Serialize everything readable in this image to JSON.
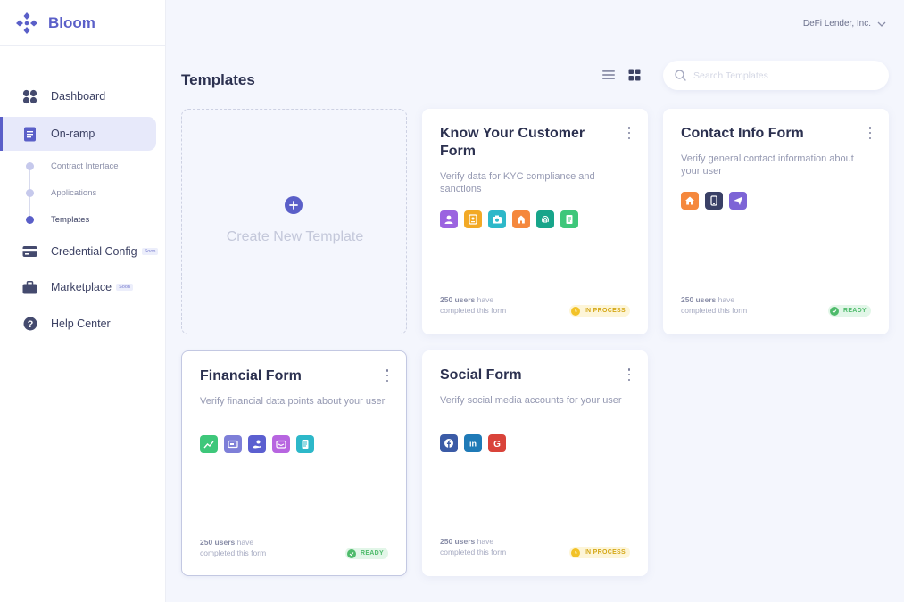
{
  "app": {
    "name": "Bloom"
  },
  "account": {
    "name": "DeFi Lender, Inc."
  },
  "sidebar": {
    "items": [
      {
        "label": "Dashboard"
      },
      {
        "label": "On-ramp"
      },
      {
        "label": "Credential Config",
        "badge": "Soon"
      },
      {
        "label": "Marketplace",
        "badge": "Soon"
      },
      {
        "label": "Help Center"
      }
    ],
    "subitems": [
      {
        "label": "Contract Interface"
      },
      {
        "label": "Applications"
      },
      {
        "label": "Templates"
      }
    ]
  },
  "page": {
    "title": "Templates"
  },
  "search": {
    "placeholder": "Search Templates"
  },
  "create": {
    "label": "Create New Template"
  },
  "cards": [
    {
      "title": "Know Your Customer Form",
      "description": "Verify data for KYC compliance and sanctions",
      "users": "250 users",
      "users_suffix": "have",
      "completed": "completed this form",
      "status": "IN PROCESS",
      "icons": [
        "user-icon",
        "id-badge-icon",
        "camera-icon",
        "home-icon",
        "fingerprint-icon",
        "document-icon"
      ]
    },
    {
      "title": "Contact Info Form",
      "description": "Verify general contact information about your user",
      "users": "250 users",
      "users_suffix": "have",
      "completed": "completed this form",
      "status": "READY",
      "icons": [
        "home-icon",
        "phone-icon",
        "send-icon"
      ]
    },
    {
      "title": "Financial Form",
      "description": "Verify financial data points about your user",
      "users": "250 users",
      "users_suffix": "have",
      "completed": "completed this form",
      "status": "READY",
      "icons": [
        "chart-line-icon",
        "card-icon",
        "hand-coin-icon",
        "wallet-icon",
        "receipt-icon"
      ]
    },
    {
      "title": "Social Form",
      "description": "Verify social media accounts for your user",
      "users": "250 users",
      "users_suffix": "have",
      "completed": "completed this form",
      "status": "IN PROCESS",
      "icons": [
        "facebook-icon",
        "linkedin-icon",
        "google-icon"
      ]
    }
  ],
  "colors": {
    "brand": "#5a5fc8",
    "in_process": "#f2c227",
    "ready": "#4ebb6b"
  }
}
